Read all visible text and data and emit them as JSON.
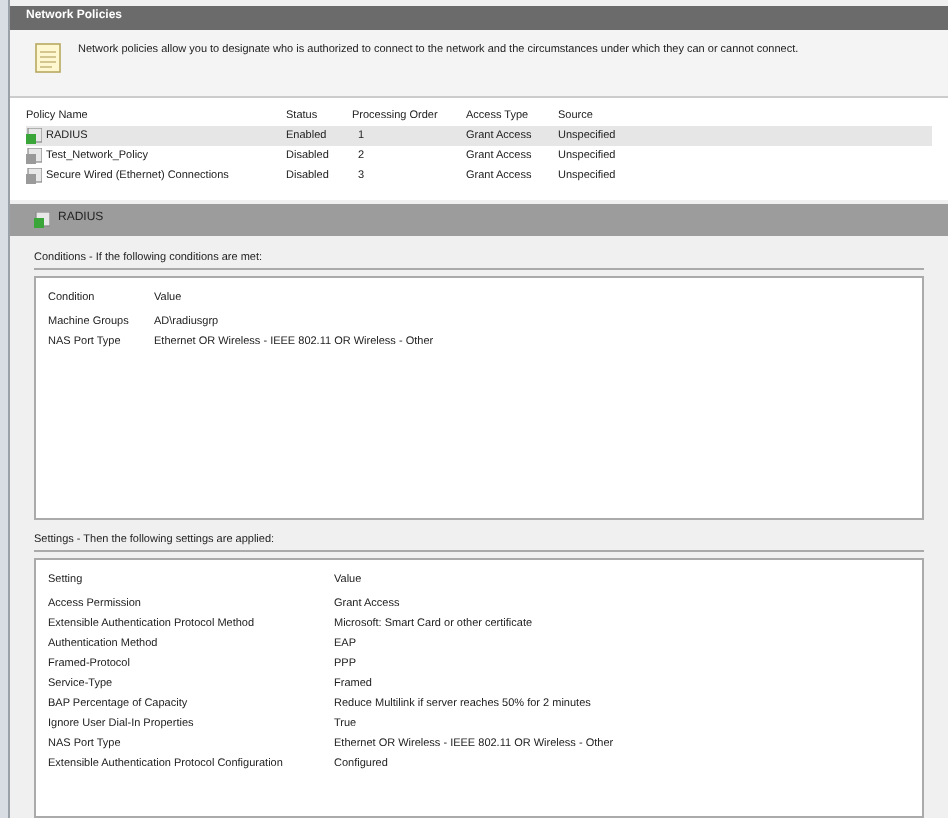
{
  "header": {
    "title": "Network Policies"
  },
  "description": "Network policies allow you to designate who is authorized to connect to the network and the circumstances under which they can or cannot connect.",
  "policies": {
    "columns": [
      "Policy Name",
      "Status",
      "Processing Order",
      "Access Type",
      "Source"
    ],
    "rows": [
      {
        "name": "RADIUS",
        "status": "Enabled",
        "order": "1",
        "access": "Grant Access",
        "source": "Unspecified",
        "enabled": true,
        "selected": true
      },
      {
        "name": "Test_Network_Policy",
        "status": "Disabled",
        "order": "2",
        "access": "Grant Access",
        "source": "Unspecified",
        "enabled": false,
        "selected": false
      },
      {
        "name": "Secure Wired (Ethernet) Connections",
        "status": "Disabled",
        "order": "3",
        "access": "Grant Access",
        "source": "Unspecified",
        "enabled": false,
        "selected": false
      }
    ]
  },
  "detail": {
    "title": "RADIUS"
  },
  "conditions": {
    "heading": "Conditions - If the following conditions are met:",
    "columns": [
      "Condition",
      "Value"
    ],
    "rows": [
      {
        "name": "Machine Groups",
        "value": "AD\\radiusgrp"
      },
      {
        "name": "NAS Port Type",
        "value": "Ethernet OR Wireless - IEEE 802.11 OR Wireless - Other"
      }
    ]
  },
  "settings": {
    "heading": "Settings - Then the following settings are applied:",
    "columns": [
      "Setting",
      "Value"
    ],
    "rows": [
      {
        "name": "Access Permission",
        "value": "Grant Access"
      },
      {
        "name": "Extensible Authentication Protocol Method",
        "value": "Microsoft: Smart Card or other certificate"
      },
      {
        "name": "Authentication Method",
        "value": "EAP"
      },
      {
        "name": "Framed-Protocol",
        "value": "PPP"
      },
      {
        "name": "Service-Type",
        "value": "Framed"
      },
      {
        "name": "BAP Percentage of Capacity",
        "value": "Reduce Multilink if server reaches 50% for 2 minutes"
      },
      {
        "name": "Ignore User Dial-In Properties",
        "value": "True"
      },
      {
        "name": "NAS Port Type",
        "value": "Ethernet OR Wireless - IEEE 802.11 OR Wireless - Other"
      },
      {
        "name": "Extensible Authentication Protocol Configuration",
        "value": "Configured"
      }
    ]
  }
}
